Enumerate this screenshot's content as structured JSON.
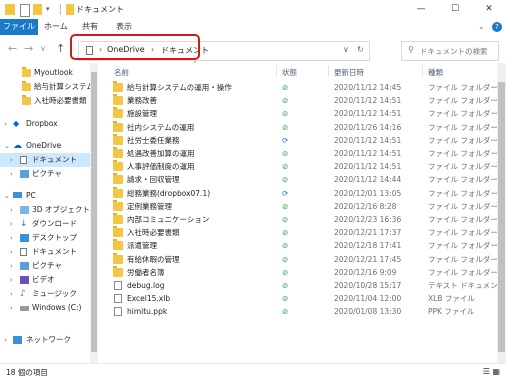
{
  "window": {
    "title": "ドキュメント",
    "minimize": "—",
    "maximize": "☐",
    "close": "✕",
    "help": "?",
    "ribbon_toggle": "⌄"
  },
  "ribbon": {
    "tabs": [
      "ファイル",
      "ホーム",
      "共有",
      "表示"
    ]
  },
  "address": {
    "segments": [
      "OneDrive",
      "ドキュメント"
    ],
    "separator": "›",
    "search_placeholder": "ドキュメントの検索",
    "highlight_color": "#d11b1b"
  },
  "nav": {
    "items": [
      {
        "label": "Myoutlook",
        "icon": "folder-icon"
      },
      {
        "label": "給与計算システム",
        "icon": "folder-icon"
      },
      {
        "label": "入社時必要書類",
        "icon": "folder-icon"
      },
      {
        "label": "Dropbox",
        "icon": "dropbox-icon"
      },
      {
        "label": "OneDrive",
        "icon": "onedrive-icon"
      },
      {
        "label": "ドキュメント",
        "icon": "documents-icon"
      },
      {
        "label": "ピクチャ",
        "icon": "pictures-icon"
      },
      {
        "label": "PC",
        "icon": "pc-icon"
      },
      {
        "label": "3D オブジェクト",
        "icon": "3d-objects-icon"
      },
      {
        "label": "ダウンロード",
        "icon": "download-icon"
      },
      {
        "label": "デスクトップ",
        "icon": "desktop-icon"
      },
      {
        "label": "ドキュメント",
        "icon": "documents-icon"
      },
      {
        "label": "ピクチャ",
        "icon": "pictures-icon"
      },
      {
        "label": "ビデオ",
        "icon": "video-icon"
      },
      {
        "label": "ミュージック",
        "icon": "music-icon"
      },
      {
        "label": "Windows (C:)",
        "icon": "drive-icon"
      },
      {
        "label": "ネットワーク",
        "icon": "network-icon"
      }
    ]
  },
  "list": {
    "columns": [
      "名前",
      "状態",
      "更新日時",
      "種類"
    ],
    "rows": [
      {
        "name": "給与計算システムの運用・操作",
        "status": "synced",
        "date": "2020/11/12 14:45",
        "type": "ファイル フォルダー",
        "kind": "folder"
      },
      {
        "name": "業務改善",
        "status": "synced",
        "date": "2020/11/12 14:51",
        "type": "ファイル フォルダー",
        "kind": "folder"
      },
      {
        "name": "施設管理",
        "status": "synced",
        "date": "2020/11/12 14:51",
        "type": "ファイル フォルダー",
        "kind": "folder"
      },
      {
        "name": "社内システムの運用",
        "status": "synced",
        "date": "2020/11/26 14:16",
        "type": "ファイル フォルダー",
        "kind": "folder"
      },
      {
        "name": "社労士委任業務",
        "status": "syncing",
        "date": "2020/11/12 14:51",
        "type": "ファイル フォルダー",
        "kind": "folder"
      },
      {
        "name": "処遇改善加算の運用",
        "status": "synced",
        "date": "2020/11/12 14:51",
        "type": "ファイル フォルダー",
        "kind": "folder"
      },
      {
        "name": "人事評価制度の運用",
        "status": "synced",
        "date": "2020/11/12 14:51",
        "type": "ファイル フォルダー",
        "kind": "folder"
      },
      {
        "name": "請求・回収管理",
        "status": "synced",
        "date": "2020/11/12 14:44",
        "type": "ファイル フォルダー",
        "kind": "folder"
      },
      {
        "name": "総務業務(dropbox07.1)",
        "status": "syncing",
        "date": "2020/12/01 13:05",
        "type": "ファイル フォルダー",
        "kind": "folder"
      },
      {
        "name": "定例業務管理",
        "status": "synced",
        "date": "2020/12/16 8:28",
        "type": "ファイル フォルダー",
        "kind": "folder"
      },
      {
        "name": "内部コミュニケーション",
        "status": "synced",
        "date": "2020/12/23 16:36",
        "type": "ファイル フォルダー",
        "kind": "folder"
      },
      {
        "name": "入社時必要書類",
        "status": "synced",
        "date": "2020/12/21 17:37",
        "type": "ファイル フォルダー",
        "kind": "folder"
      },
      {
        "name": "派遣管理",
        "status": "synced",
        "date": "2020/12/18 17:41",
        "type": "ファイル フォルダー",
        "kind": "folder"
      },
      {
        "name": "有給休暇の管理",
        "status": "synced",
        "date": "2020/12/21 17:45",
        "type": "ファイル フォルダー",
        "kind": "folder"
      },
      {
        "name": "労働者名簿",
        "status": "synced",
        "date": "2020/12/16 9:09",
        "type": "ファイル フォルダー",
        "kind": "folder"
      },
      {
        "name": "debug.log",
        "status": "synced",
        "date": "2020/10/28 15:17",
        "type": "テキスト ドキュメント",
        "kind": "file"
      },
      {
        "name": "Excel15.xlb",
        "status": "synced",
        "date": "2020/11/04 12:00",
        "type": "XLB ファイル",
        "kind": "file"
      },
      {
        "name": "himitu.ppk",
        "status": "synced",
        "date": "2020/01/08 13:30",
        "type": "PPK ファイル",
        "kind": "file"
      }
    ]
  },
  "status": {
    "item_count": "18 個の項目"
  },
  "colors": {
    "accent": "#1979ca",
    "synced": "#2e9e46",
    "syncing": "#1a73e8",
    "folder": "#f4c643"
  }
}
